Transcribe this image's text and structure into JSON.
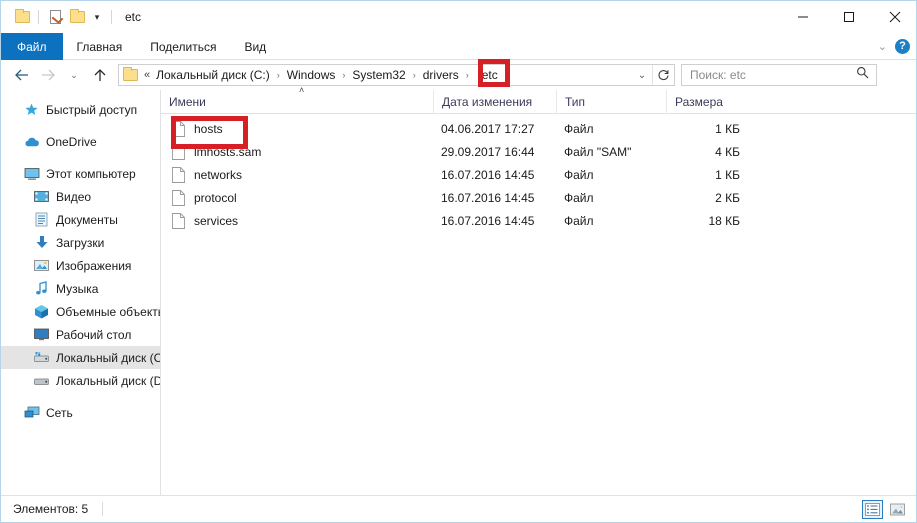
{
  "window": {
    "title": "etc",
    "quick_access": [
      "folder-icon",
      "properties-icon",
      "new-folder-icon",
      "customize-caret-icon"
    ],
    "controls": {
      "minimize": "minimize-icon",
      "maximize": "maximize-icon",
      "close": "close-icon"
    }
  },
  "ribbon": {
    "tabs": [
      {
        "label": "Файл",
        "active": true
      },
      {
        "label": "Главная",
        "active": false
      },
      {
        "label": "Поделиться",
        "active": false
      },
      {
        "label": "Вид",
        "active": false
      }
    ],
    "expand_icon": "chevron-down-icon",
    "help_label": "?"
  },
  "navigation": {
    "back": "back-arrow-icon",
    "forward": "forward-arrow-icon",
    "recent": "chevron-down-icon",
    "up": "up-arrow-icon"
  },
  "address": {
    "overflow": "«",
    "crumbs": [
      "Локальный диск (C:)",
      "Windows",
      "System32",
      "drivers",
      "etc"
    ],
    "separator": "›",
    "dropdown_icon": "chevron-down-icon",
    "refresh_icon": "refresh-icon"
  },
  "search": {
    "placeholder": "Поиск: etc",
    "icon": "search-icon"
  },
  "sidebar": {
    "items": [
      {
        "label": "Быстрый доступ",
        "icon": "star-pin-icon",
        "level": 0,
        "selected": false
      },
      {
        "label": "OneDrive",
        "icon": "cloud-icon",
        "level": 0,
        "selected": false
      },
      {
        "label": "Этот компьютер",
        "icon": "computer-icon",
        "level": 0,
        "selected": false
      },
      {
        "label": "Видео",
        "icon": "video-icon",
        "level": 1,
        "selected": false
      },
      {
        "label": "Документы",
        "icon": "documents-icon",
        "level": 1,
        "selected": false
      },
      {
        "label": "Загрузки",
        "icon": "downloads-icon",
        "level": 1,
        "selected": false
      },
      {
        "label": "Изображения",
        "icon": "pictures-icon",
        "level": 1,
        "selected": false
      },
      {
        "label": "Музыка",
        "icon": "music-icon",
        "level": 1,
        "selected": false
      },
      {
        "label": "Объемные объекты",
        "icon": "3d-objects-icon",
        "level": 1,
        "selected": false
      },
      {
        "label": "Рабочий стол",
        "icon": "desktop-icon",
        "level": 1,
        "selected": false
      },
      {
        "label": "Локальный диск (C",
        "icon": "system-drive-icon",
        "level": 1,
        "selected": true
      },
      {
        "label": "Локальный диск (D",
        "icon": "drive-icon",
        "level": 1,
        "selected": false
      },
      {
        "label": "Сеть",
        "icon": "network-icon",
        "level": 0,
        "selected": false
      }
    ]
  },
  "filelist": {
    "columns": [
      {
        "label": "Имени",
        "sorted": "asc"
      },
      {
        "label": "Дата изменения",
        "sorted": ""
      },
      {
        "label": "Тип",
        "sorted": ""
      },
      {
        "label": "Размера",
        "sorted": ""
      }
    ],
    "sort_arrow": "˄",
    "rows": [
      {
        "name": "hosts",
        "date": "04.06.2017 17:27",
        "type": "Файл",
        "size": "1 КБ",
        "icon": "file-icon"
      },
      {
        "name": "lmhosts.sam",
        "date": "29.09.2017 16:44",
        "type": "Файл \"SAM\"",
        "size": "4 КБ",
        "icon": "file-icon"
      },
      {
        "name": "networks",
        "date": "16.07.2016 14:45",
        "type": "Файл",
        "size": "1 КБ",
        "icon": "file-icon"
      },
      {
        "name": "protocol",
        "date": "16.07.2016 14:45",
        "type": "Файл",
        "size": "2 КБ",
        "icon": "file-icon"
      },
      {
        "name": "services",
        "date": "16.07.2016 14:45",
        "type": "Файл",
        "size": "18 КБ",
        "icon": "file-icon"
      }
    ]
  },
  "statusbar": {
    "items_text": "Элементов: 5",
    "view_details": "details-view-icon",
    "view_large_icons": "large-icons-view-icon"
  },
  "annotations": {
    "color": "#d61f26",
    "boxes": [
      "etc-breadcrumb",
      "hosts-file-row"
    ]
  }
}
